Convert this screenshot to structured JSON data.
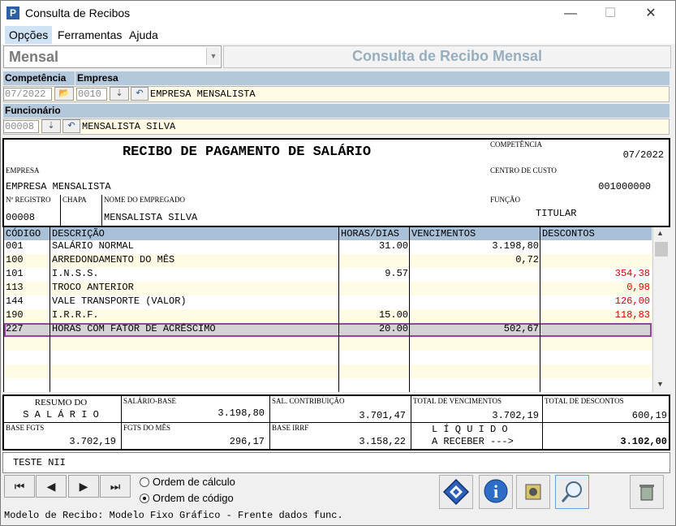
{
  "window": {
    "title": "Consulta de Recibos",
    "minimize": "—",
    "maximize": "☐",
    "close": "✕",
    "app_icon": "P"
  },
  "menu": {
    "items": [
      "Opções",
      "Ferramentas",
      "Ajuda"
    ]
  },
  "mode_select": {
    "value": "Mensal"
  },
  "header": {
    "title": "Consulta de Recibo Mensal"
  },
  "filters": {
    "competencia_label": "Competência",
    "empresa_label": "Empresa",
    "competencia_value": "07/2022",
    "empresa_code": "0010",
    "empresa_name": "EMPRESA MENSALISTA",
    "funcionario_label": "Funcionário",
    "funcionario_code": "00008",
    "funcionario_name": "MENSALISTA SILVA"
  },
  "receipt": {
    "title": "RECIBO DE PAGAMENTO DE SALÁRIO",
    "competencia_label": "COMPETÊNCIA",
    "competencia_value": "07/2022",
    "empresa_label": "EMPRESA",
    "empresa_value": "EMPRESA MENSALISTA",
    "centro_label": "CENTRO DE CUSTO",
    "centro_value": "001000000",
    "registro_label": "Nº REGISTRO",
    "registro_value": "00008",
    "chapa_label": "CHAPA",
    "nome_label": "NOME DO EMPREGADO",
    "nome_value": "MENSALISTA SILVA",
    "funcao_label": "FUNÇÃO",
    "funcao_value": "TITULAR"
  },
  "table": {
    "headers": [
      "CÓDIGO",
      "DESCRIÇÃO",
      "HORAS/DIAS",
      "VENCIMENTOS",
      "DESCONTOS"
    ],
    "rows": [
      {
        "code": "001",
        "desc": "SALÁRIO NORMAL",
        "horas": "31.00",
        "venc": "3.198,80",
        "desc_val": ""
      },
      {
        "code": "100",
        "desc": "ARREDONDAMENTO DO MÊS",
        "horas": "",
        "venc": "0,72",
        "desc_val": ""
      },
      {
        "code": "101",
        "desc": "I.N.S.S.",
        "horas": "9.57",
        "venc": "",
        "desc_val": "354,38"
      },
      {
        "code": "113",
        "desc": "TROCO ANTERIOR",
        "horas": "",
        "venc": "",
        "desc_val": "0,98"
      },
      {
        "code": "144",
        "desc": "VALE TRANSPORTE (VALOR)",
        "horas": "",
        "venc": "",
        "desc_val": "126,00"
      },
      {
        "code": "190",
        "desc": "I.R.R.F.",
        "horas": "15.00",
        "venc": "",
        "desc_val": "118,83"
      },
      {
        "code": "227",
        "desc": "HORAS COM FATOR DE ACRÉSCIMO",
        "horas": "20.00",
        "venc": "502,67",
        "desc_val": ""
      }
    ]
  },
  "summary": {
    "resumo_line1": "RESUMO DO",
    "resumo_line2": "S A L Á R I O",
    "salario_base_label": "SALÁRIO-BASE",
    "salario_base_value": "3.198,80",
    "sal_contrib_label": "SAL. CONTRIBUIÇÃO",
    "sal_contrib_value": "3.701,47",
    "total_venc_label": "TOTAL DE VENCIMENTOS",
    "total_venc_value": "3.702,19",
    "total_desc_label": "TOTAL DE DESCONTOS",
    "total_desc_value": "600,19",
    "base_fgts_label": "BASE FGTS",
    "base_fgts_value": "3.702,19",
    "fgts_mes_label": "FGTS DO MÊS",
    "fgts_mes_value": "296,17",
    "base_irrf_label": "BASE IRRF",
    "base_irrf_value": "3.158,22",
    "liquido_line1": "L Í Q U I D O",
    "liquido_line2": "A RECEBER --->",
    "liquido_value": "3.102,00"
  },
  "note": {
    "text": "TESTE NII"
  },
  "order": {
    "calc_label": "Ordem de cálculo",
    "code_label": "Ordem de código",
    "selected": "code"
  },
  "status": {
    "text": "Modelo de Recibo: Modelo Fixo Gráfico - Frente dados func."
  },
  "colors": {
    "desconto_red": "#e00000",
    "header_blue": "#a8c0d8",
    "row_yellow": "#fffbe5",
    "selected_border": "#9b3fa0"
  }
}
